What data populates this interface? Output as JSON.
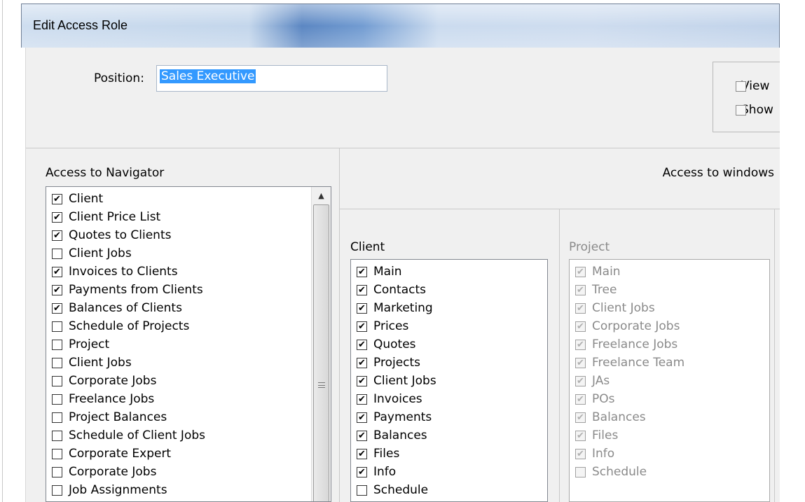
{
  "dialog": {
    "title": "Edit Access Role"
  },
  "position": {
    "label": "Position:",
    "value": "Sales Executive"
  },
  "options": [
    {
      "label": "View",
      "checked": false
    },
    {
      "label": "Show",
      "checked": false
    }
  ],
  "navigator": {
    "header": "Access to Navigator",
    "items": [
      {
        "label": "Client",
        "checked": true
      },
      {
        "label": "Client Price List",
        "checked": true
      },
      {
        "label": "Quotes to Clients",
        "checked": true
      },
      {
        "label": "Client Jobs",
        "checked": false
      },
      {
        "label": "Invoices to Clients",
        "checked": true
      },
      {
        "label": "Payments from Clients",
        "checked": true
      },
      {
        "label": "Balances of Clients",
        "checked": true
      },
      {
        "label": "Schedule of Projects",
        "checked": false
      },
      {
        "label": "Project",
        "checked": false
      },
      {
        "label": "Client Jobs",
        "checked": false
      },
      {
        "label": "Corporate Jobs",
        "checked": false
      },
      {
        "label": "Freelance Jobs",
        "checked": false
      },
      {
        "label": "Project Balances",
        "checked": false
      },
      {
        "label": "Schedule of Client Jobs",
        "checked": false
      },
      {
        "label": "Corporate Expert",
        "checked": false
      },
      {
        "label": "Corporate Jobs",
        "checked": false
      },
      {
        "label": "Job Assignments",
        "checked": false
      }
    ]
  },
  "windows": {
    "header": "Access to windows",
    "client": {
      "label": "Client",
      "items": [
        {
          "label": "Main",
          "checked": true
        },
        {
          "label": "Contacts",
          "checked": true
        },
        {
          "label": "Marketing",
          "checked": true
        },
        {
          "label": "Prices",
          "checked": true
        },
        {
          "label": "Quotes",
          "checked": true
        },
        {
          "label": "Projects",
          "checked": true
        },
        {
          "label": "Client Jobs",
          "checked": true
        },
        {
          "label": "Invoices",
          "checked": true
        },
        {
          "label": "Payments",
          "checked": true
        },
        {
          "label": "Balances",
          "checked": true
        },
        {
          "label": "Files",
          "checked": true
        },
        {
          "label": "Info",
          "checked": true
        },
        {
          "label": "Schedule",
          "checked": false
        }
      ]
    },
    "project": {
      "label": "Project",
      "disabled": true,
      "items": [
        {
          "label": "Main",
          "checked": true
        },
        {
          "label": "Tree",
          "checked": true
        },
        {
          "label": "Client Jobs",
          "checked": true
        },
        {
          "label": "Corporate Jobs",
          "checked": true
        },
        {
          "label": "Freelance Jobs",
          "checked": true
        },
        {
          "label": "Freelance Team",
          "checked": true
        },
        {
          "label": "JAs",
          "checked": true
        },
        {
          "label": "POs",
          "checked": true
        },
        {
          "label": "Balances",
          "checked": true
        },
        {
          "label": "Files",
          "checked": true
        },
        {
          "label": "Info",
          "checked": true
        },
        {
          "label": "Schedule",
          "checked": false
        }
      ]
    }
  }
}
